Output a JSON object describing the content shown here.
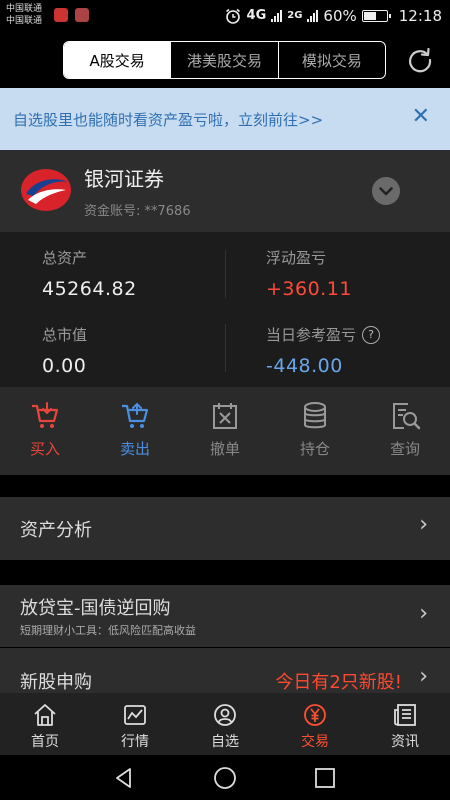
{
  "status_bar": {
    "carrier_1": "中国联通",
    "carrier_2": "中国联通",
    "network_1": "4G",
    "network_2": "2G",
    "battery": "60%",
    "battery_level": 0.6,
    "time": "12:18",
    "icons": [
      "app-notification-icon",
      "app-notification-icon",
      "alarm-icon",
      "signal-icon",
      "battery-icon"
    ]
  },
  "top_nav": {
    "tabs": [
      "A股交易",
      "港美股交易",
      "模拟交易"
    ],
    "active_tab": 0,
    "refresh_icon": "refresh-icon"
  },
  "banner": {
    "text": "自选股里也能随时看资产盈亏啦，立刻前往>>",
    "close_icon": "close-icon",
    "bg_color": "#c7dcf0",
    "text_color": "#2f6fb2"
  },
  "broker": {
    "name": "银河证券",
    "account": "资金账号: **7686",
    "dropdown_icon": "chevron-down-icon"
  },
  "stats": {
    "total_assets_label": "总资产",
    "total_assets": "45264.82",
    "floating_pl_label": "浮动盈亏",
    "floating_pl": "+360.11",
    "market_value_label": "总市值",
    "market_value": "0.00",
    "daily_pl_label": "当日参考盈亏",
    "daily_pl": "-448.00",
    "help_icon": "?",
    "positive_color": "#ff4a3a",
    "negative_color": "#6aa7e8"
  },
  "actions": [
    {
      "label": "买入",
      "icon": "cart-buy-icon",
      "color": "#e8453c"
    },
    {
      "label": "卖出",
      "icon": "cart-sell-icon",
      "color": "#4a8fe0"
    },
    {
      "label": "撤单",
      "icon": "cancel-order-icon",
      "color": "#999"
    },
    {
      "label": "持仓",
      "icon": "holdings-icon",
      "color": "#999"
    },
    {
      "label": "查询",
      "icon": "query-icon",
      "color": "#999"
    }
  ],
  "menu": {
    "asset_analysis": "资产分析",
    "repo_title": "放贷宝-国债逆回购",
    "repo_sub": "短期理财小工具：低风险匹配高收益",
    "ipo_title": "新股申购",
    "ipo_highlight": "今日有2只新股!",
    "chevron": "›"
  },
  "tabbar": [
    {
      "label": "首页",
      "icon": "home-icon"
    },
    {
      "label": "行情",
      "icon": "market-chart-icon"
    },
    {
      "label": "自选",
      "icon": "watchlist-icon"
    },
    {
      "label": "交易",
      "icon": "trade-yuan-icon",
      "active": true
    },
    {
      "label": "资讯",
      "icon": "news-icon"
    }
  ],
  "accent_color": "#ff5030"
}
